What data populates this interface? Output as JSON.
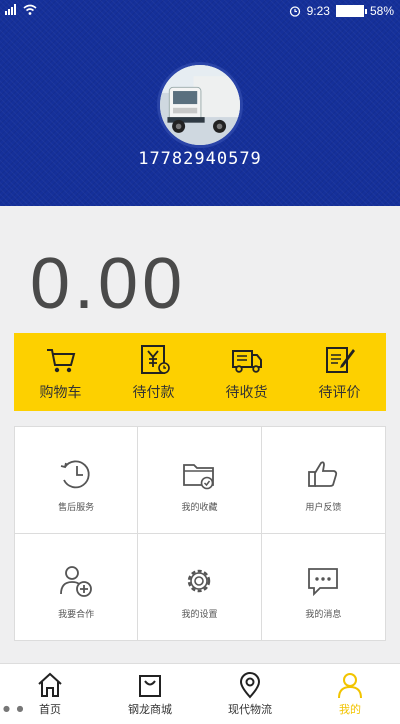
{
  "status_bar": {
    "time": "9:23",
    "battery": "58%",
    "icons": [
      "signal-icon",
      "wifi-icon",
      "alarm-icon",
      "battery-icon"
    ]
  },
  "profile": {
    "phone": "17782940579",
    "avatar": "truck-photo"
  },
  "balance": "0.00",
  "orders": [
    {
      "label": "购物车",
      "icon": "cart-icon"
    },
    {
      "label": "待付款",
      "icon": "yen-bill-icon"
    },
    {
      "label": "待收货",
      "icon": "truck-icon"
    },
    {
      "label": "待评价",
      "icon": "pen-note-icon"
    }
  ],
  "services": [
    {
      "label": "售后服务",
      "icon": "clock-icon"
    },
    {
      "label": "我的收藏",
      "icon": "folder-icon"
    },
    {
      "label": "用户反馈",
      "icon": "thumbs-up-icon"
    },
    {
      "label": "我要合作",
      "icon": "add-user-icon"
    },
    {
      "label": "我的设置",
      "icon": "gear-icon"
    },
    {
      "label": "我的消息",
      "icon": "message-icon"
    }
  ],
  "tabs": [
    {
      "label": "首页",
      "icon": "home-icon"
    },
    {
      "label": "钢龙商城",
      "icon": "shopping-bag-icon"
    },
    {
      "label": "现代物流",
      "icon": "location-icon"
    },
    {
      "label": "我的",
      "icon": "user-icon",
      "active": true
    }
  ],
  "colors": {
    "header_bg": "#15309a",
    "accent_yellow": "#fdd000",
    "active_tab": "#f2c400"
  }
}
